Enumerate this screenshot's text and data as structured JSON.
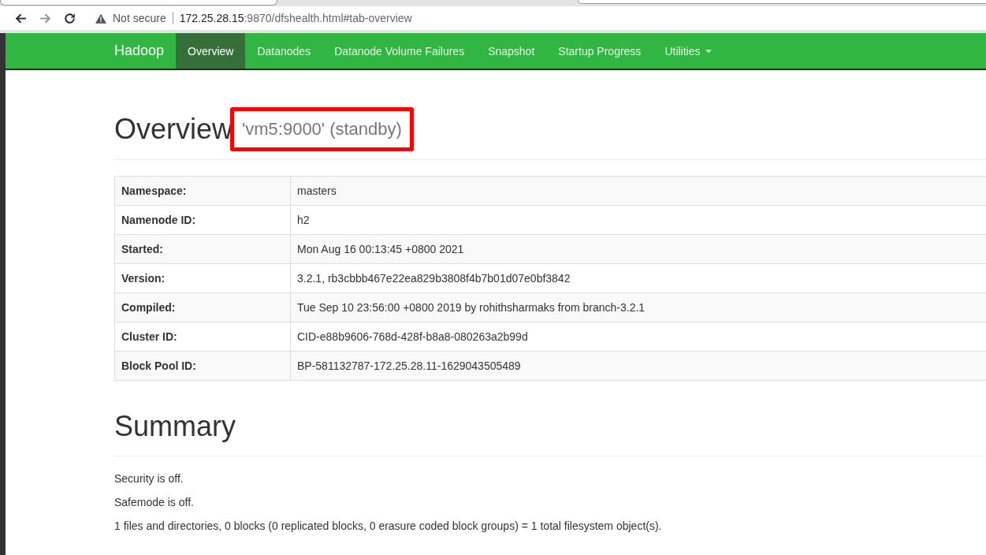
{
  "browser": {
    "security": "Not secure",
    "url_host": "172.25.28.15",
    "url_rest": ":9870/dfshealth.html#tab-overview"
  },
  "navbar": {
    "brand": "Hadoop",
    "items": [
      {
        "label": "Overview",
        "selected": true,
        "dropdown": false
      },
      {
        "label": "Datanodes",
        "selected": false,
        "dropdown": false
      },
      {
        "label": "Datanode Volume Failures",
        "selected": false,
        "dropdown": false
      },
      {
        "label": "Snapshot",
        "selected": false,
        "dropdown": false
      },
      {
        "label": "Startup Progress",
        "selected": false,
        "dropdown": false
      },
      {
        "label": "Utilities",
        "selected": false,
        "dropdown": true
      }
    ]
  },
  "overview": {
    "title": "Overview",
    "subtitle": "'vm5:9000' (standby)",
    "highlighted": true
  },
  "info_table": [
    {
      "label": "Namespace:",
      "value": "masters"
    },
    {
      "label": "Namenode ID:",
      "value": "h2"
    },
    {
      "label": "Started:",
      "value": "Mon Aug 16 00:13:45 +0800 2021"
    },
    {
      "label": "Version:",
      "value": "3.2.1, rb3cbbb467e22ea829b3808f4b7b01d07e0bf3842"
    },
    {
      "label": "Compiled:",
      "value": "Tue Sep 10 23:56:00 +0800 2019 by rohithsharmaks from branch-3.2.1"
    },
    {
      "label": "Cluster ID:",
      "value": "CID-e88b9606-768d-428f-b8a8-080263a2b99d"
    },
    {
      "label": "Block Pool ID:",
      "value": "BP-581132787-172.25.28.11-1629043505489"
    }
  ],
  "summary": {
    "title": "Summary",
    "lines": [
      "Security is off.",
      "Safemode is off.",
      "1 files and directories, 0 blocks (0 replicated blocks, 0 erasure coded block groups) = 1 total filesystem object(s)."
    ]
  }
}
